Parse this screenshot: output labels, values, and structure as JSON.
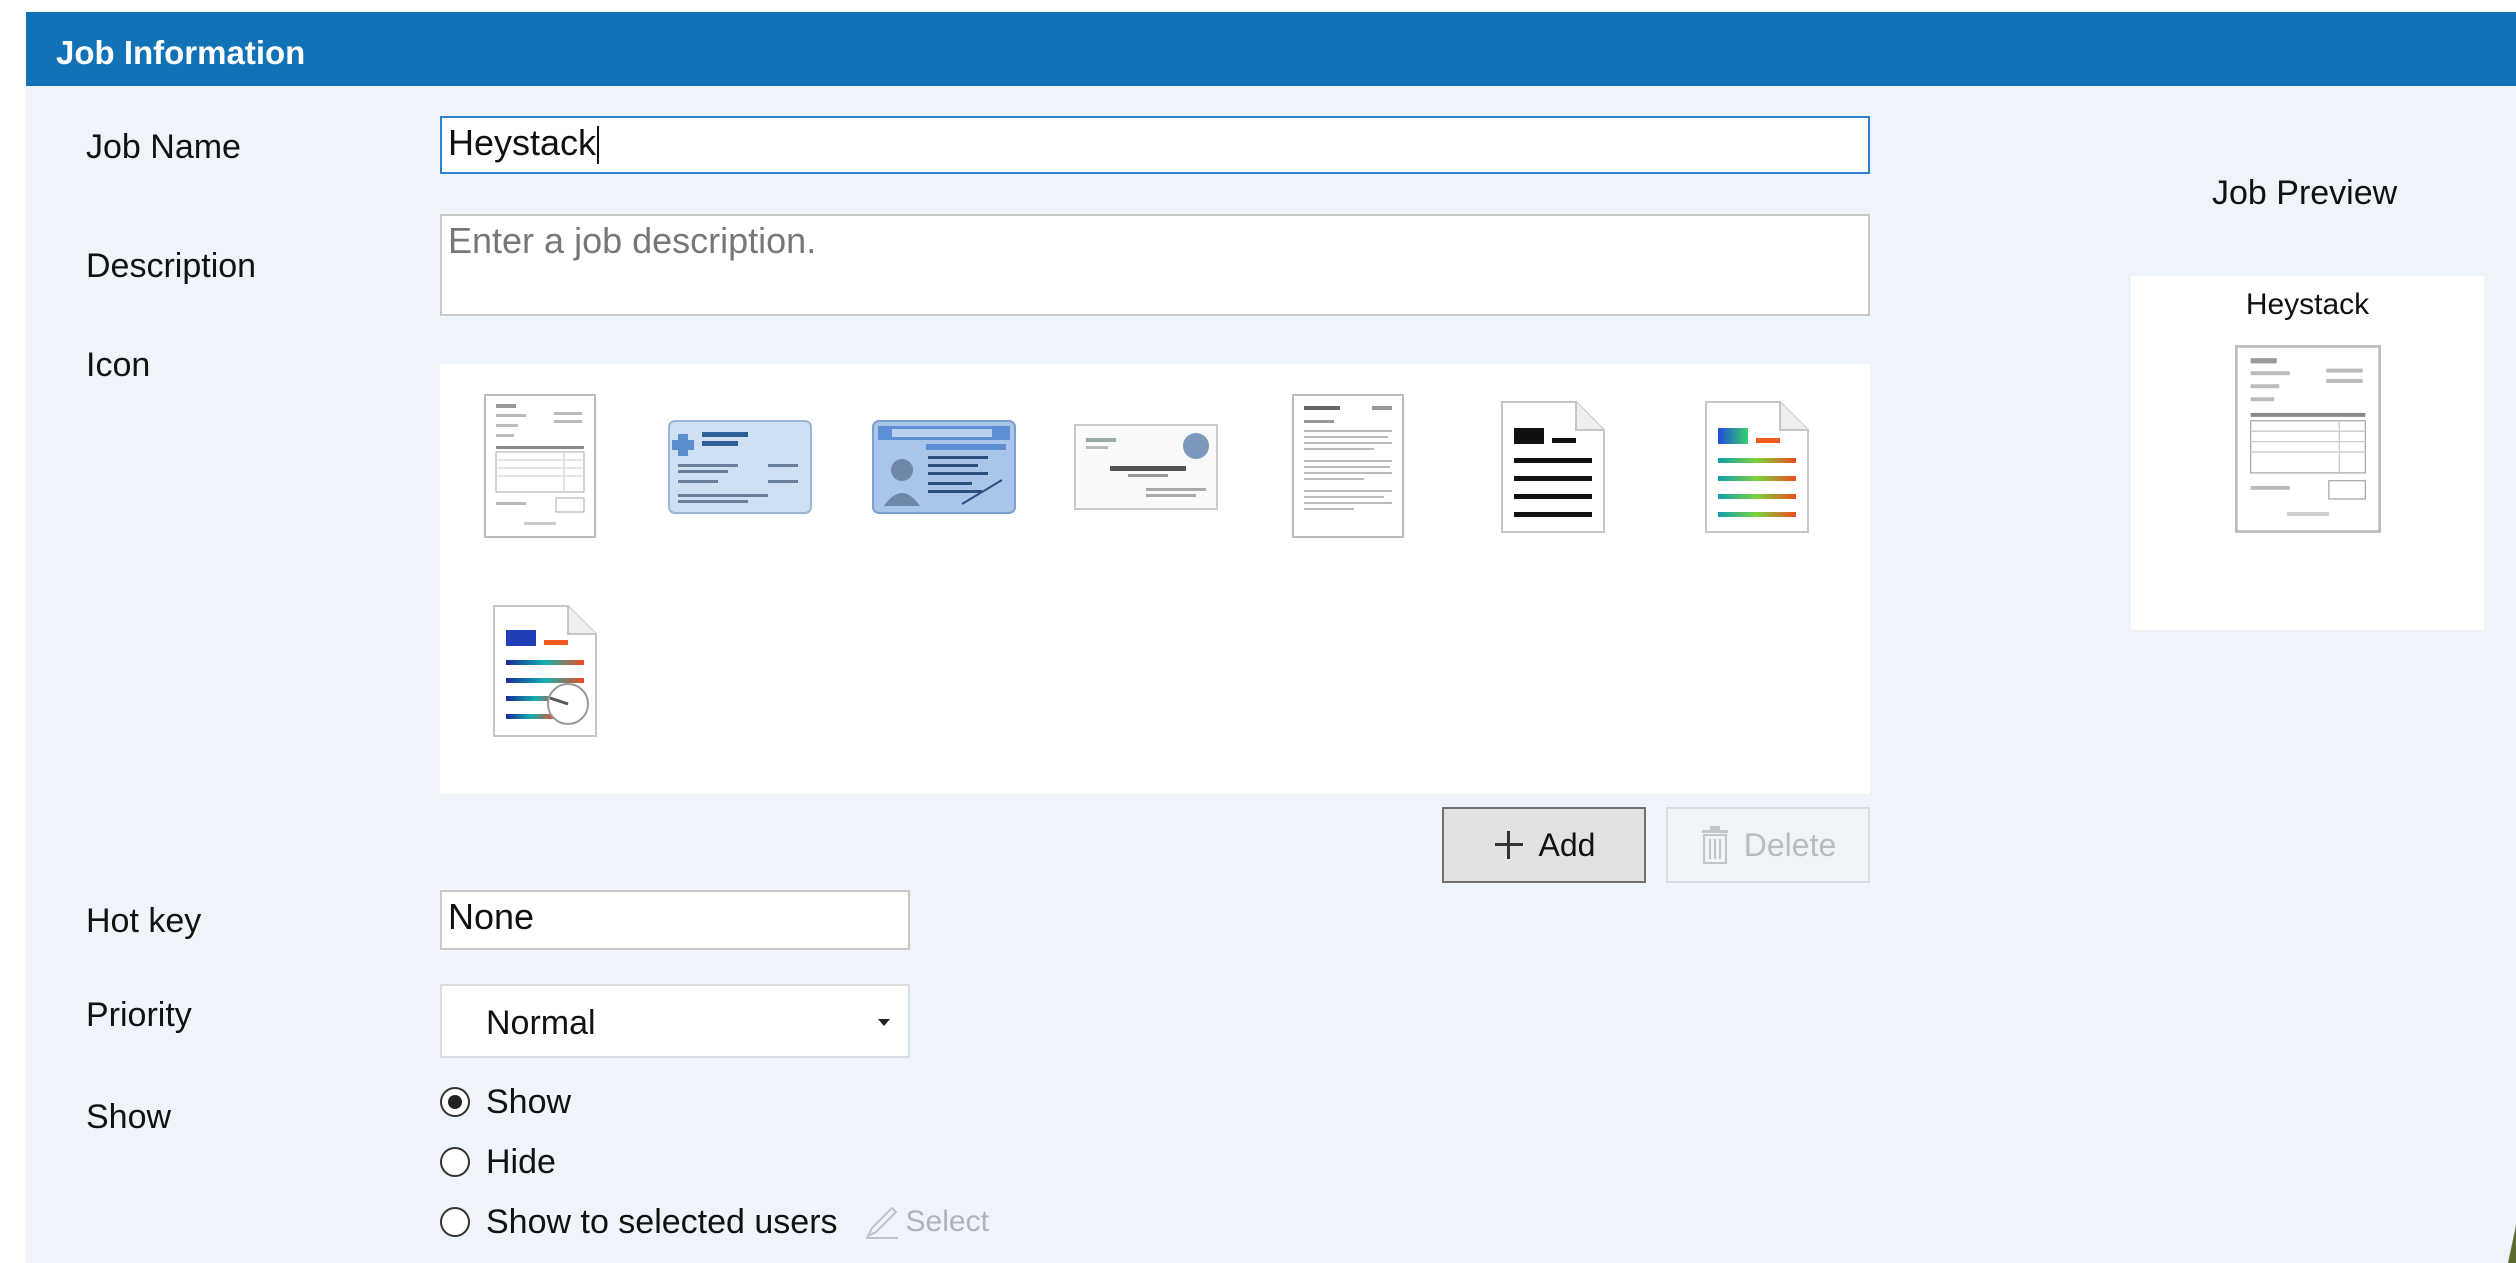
{
  "panel": {
    "title": "Job Information",
    "header_color": "#1172b6",
    "background_color": "#eef4f9"
  },
  "form": {
    "job_name_label": "Job Name",
    "job_name_value": "Heystack",
    "description_label": "Description",
    "description_placeholder": "Enter a job description.",
    "icon_label": "Icon",
    "icons": [
      "invoice-document-icon",
      "insurance-card-icon",
      "driver-license-icon",
      "business-card-icon",
      "text-document-icon",
      "black-text-page-icon",
      "color-text-page-icon",
      "color-scan-page-icon"
    ],
    "add_label": "Add",
    "delete_label": "Delete",
    "hotkey_label": "Hot key",
    "hotkey_value": "None",
    "priority_label": "Priority",
    "priority_value": "Normal",
    "show_label": "Show",
    "show_options": [
      "Show",
      "Hide",
      "Show to selected users"
    ],
    "show_selected_index": 0,
    "select_label": "Select"
  },
  "preview": {
    "title": "Job Preview",
    "job_name": "Heystack",
    "thumbnail_icon": "invoice-document-icon"
  }
}
